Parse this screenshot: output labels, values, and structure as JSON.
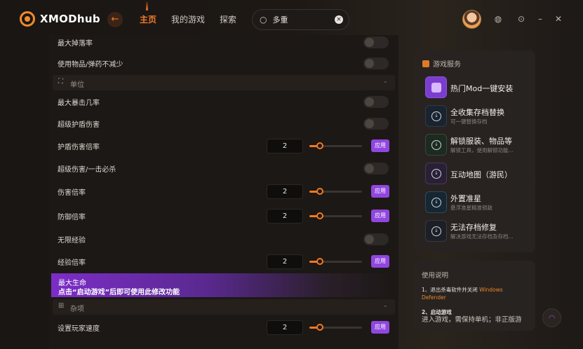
{
  "app": {
    "title": "XMODhub"
  },
  "nav": {
    "items": [
      "主页",
      "我的游戏",
      "探索"
    ]
  },
  "search": {
    "value": "多重"
  },
  "rows": [
    {
      "label": "最大掉落率",
      "type": "toggle"
    },
    {
      "label": "使用物品/弹药不减少",
      "type": "toggle"
    },
    {
      "label": "单位",
      "type": "section"
    },
    {
      "label": "最大暴击几率",
      "type": "toggle"
    },
    {
      "label": "超级护盾伤害",
      "type": "toggle"
    },
    {
      "label": "护盾伤害倍率",
      "type": "slider",
      "value": "2",
      "progress": 0.2,
      "apply_label": "应用"
    },
    {
      "label": "超级伤害/一击必杀",
      "type": "toggle"
    },
    {
      "label": "伤害倍率",
      "type": "slider",
      "value": "2",
      "progress": 0.2,
      "apply_label": "应用"
    },
    {
      "label": "防御倍率",
      "type": "slider",
      "value": "2",
      "progress": 0.2,
      "apply_label": "应用"
    },
    {
      "label": "无限经验",
      "type": "toggle"
    },
    {
      "label": "经验倍率",
      "type": "slider",
      "value": "2",
      "progress": 0.2,
      "apply_label": "应用"
    }
  ],
  "warning": {
    "label": "最大生命",
    "message": "点击“启动游戏”后即可使用此修改功能"
  },
  "misc_section": {
    "label": "杂项"
  },
  "misc_rows": [
    {
      "label": "设置玩家速度",
      "value": "2",
      "progress": 0.2,
      "apply_label": "应用"
    }
  ],
  "services": {
    "title": "游戏服务",
    "items": [
      {
        "name": "热门Mod一键安装",
        "desc": "",
        "icon": "mod-icon"
      },
      {
        "name": "全收集存档替换",
        "desc": "可一键替换存档",
        "icon": "download-icon"
      },
      {
        "name": "解锁服装、物品等",
        "desc": "解锁工具，使用解锁功能...",
        "icon": "download-icon"
      },
      {
        "name": "互动地图（游民）",
        "desc": "",
        "icon": "map-icon"
      },
      {
        "name": "外置准星",
        "desc": "悬浮准星精准锁敌",
        "icon": "download-icon"
      },
      {
        "name": "无法存档修复",
        "desc": "解决游戏无法存档及存档...",
        "icon": "download-icon"
      }
    ]
  },
  "help": {
    "title": "使用说明",
    "step1": "1、退出杀毒软件并关闭",
    "step1_hl": "Windows Defender",
    "step2_title": "2、启动游戏",
    "step2_body": "进入游戏，需保持单机；非正版游"
  },
  "colors": {
    "accent": "#f07a22",
    "apply": "#9146e0"
  }
}
